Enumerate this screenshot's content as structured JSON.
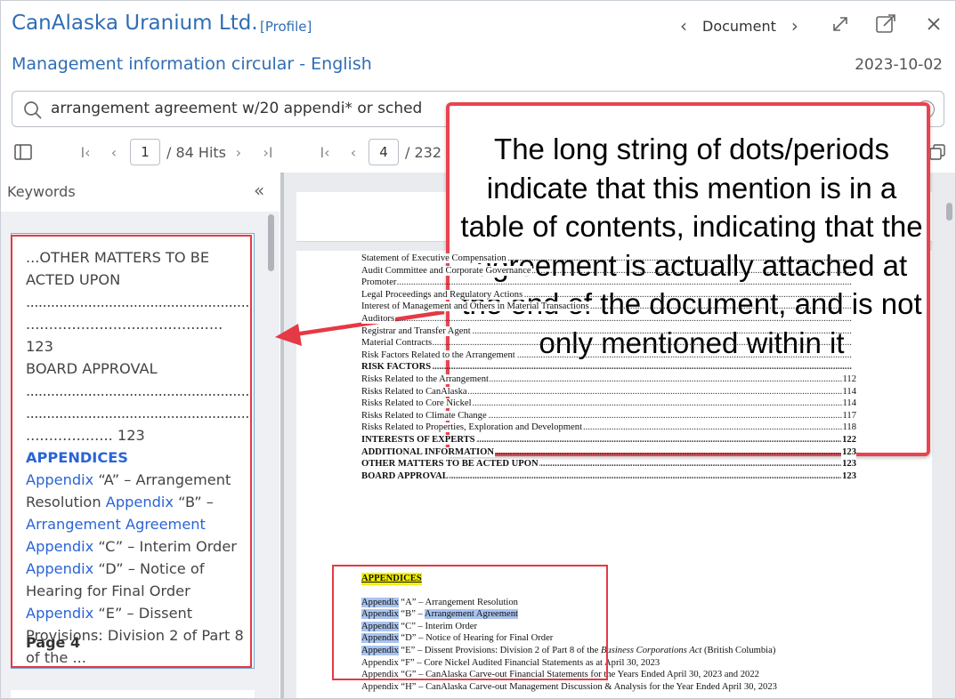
{
  "header": {
    "company": "CanAlaska Uranium Ltd.",
    "profile_link": "[Profile]",
    "doc_nav_label": "Document",
    "prev_icon": "chevron-left-icon",
    "next_icon": "chevron-right-icon",
    "expand_icon": "expand-icon",
    "open_external_icon": "open-external-icon",
    "close_icon": "close-icon",
    "subtitle": "Management information circular - English",
    "date": "2023-10-02"
  },
  "search": {
    "value": "arrangement agreement w/20 appendi* or sched"
  },
  "toolbar": {
    "hit_current": "1",
    "hit_total": "/ 84 Hits",
    "page_current": "4",
    "page_total": "/ 232"
  },
  "keywords_panel": {
    "label": "Keywords",
    "collapse_icon": "double-chevron-left-icon",
    "snippet": {
      "line1": "...OTHER MATTERS TO BE ACTED UPON",
      "dots1": "..............................................................",
      "dots2": "...........................................",
      "num1": "123",
      "line2": "BOARD APPROVAL",
      "dots3": "..............................................................",
      "dots4": "..............................................................",
      "dots5": "...................",
      "num2": "123",
      "kw_appendices": "APPENDICES",
      "kw_appendix": "Appendix",
      "a_text": "“A” – Arrangement Resolution",
      "b_text": "“B” –",
      "kw_arrangement_agreement": "Arrangement Agreement",
      "c_text": "“C” – Interim Order",
      "d_text": "“D” – Notice of Hearing for Final Order",
      "e_text": "“E” – Dissent Provisions: Division 2 of Part 8 of the ..."
    },
    "page_label": "Page 4"
  },
  "document": {
    "toc": [
      {
        "title": "Statement of Executive Compensation",
        "page": "",
        "bold": false
      },
      {
        "title": "Audit Committee and Corporate Governance",
        "page": "",
        "bold": false
      },
      {
        "title": "Promoter",
        "page": "",
        "bold": false
      },
      {
        "title": "Legal Proceedings and Regulatory Actions",
        "page": "",
        "bold": false
      },
      {
        "title": "Interest of Management and Others in Material Transactions",
        "page": "",
        "bold": false
      },
      {
        "title": "Auditors",
        "page": "",
        "bold": false
      },
      {
        "title": "Registrar and Transfer Agent",
        "page": "",
        "bold": false
      },
      {
        "title": "Material Contracts",
        "page": "",
        "bold": false
      },
      {
        "title": "Risk Factors Related to the Arrangement",
        "page": "",
        "bold": false
      },
      {
        "title": "RISK FACTORS",
        "page": "",
        "bold": true
      },
      {
        "title": "Risks Related to the Arrangement",
        "page": "112",
        "bold": false
      },
      {
        "title": "Risks Related to CanAlaska",
        "page": "114",
        "bold": false
      },
      {
        "title": "Risks Related to Core Nickel",
        "page": "114",
        "bold": false
      },
      {
        "title": "Risks Related to Climate Change",
        "page": "117",
        "bold": false
      },
      {
        "title": "Risks Related to Properties, Exploration and Development",
        "page": "118",
        "bold": false
      },
      {
        "title": "INTERESTS OF EXPERTS",
        "page": "122",
        "bold": true
      },
      {
        "title": "ADDITIONAL INFORMATION",
        "page": "123",
        "bold": true
      },
      {
        "title": "OTHER MATTERS TO BE ACTED UPON",
        "page": "123",
        "bold": true
      },
      {
        "title": "BOARD APPROVAL",
        "page": "123",
        "bold": true
      }
    ],
    "dot_leader": "................................................................................................................................................................................................................",
    "appendices_heading": "APPENDICES",
    "appendix_word": "Appendix",
    "arrangement_agreement": "Arrangement Agreement",
    "appx_a": " “A” – Arrangement Resolution",
    "appx_b": " “B” – ",
    "appx_c": " “C” – Interim Order",
    "appx_d": " “D” – Notice of Hearing for Final Order",
    "appx_e_pre": " “E” – Dissent Provisions: Division 2 of Part 8 of the ",
    "appx_e_italic": "Business Corporations Act",
    "appx_e_post": " (British Columbia)",
    "appx_f": "Appendix “F” – Core Nickel Audited Financial Statements as at April 30, 2023",
    "appx_g": "Appendix “G” – CanAlaska Carve-out Financial Statements for the Years Ended April 30, 2023 and 2022",
    "appx_h": "Appendix “H” – CanAlaska Carve-out Management Discussion & Analysis for the Year Ended April 30, 2023"
  },
  "callout": {
    "text": "The long string of dots/periods indicate that this mention is in a table of contents, indicating that the agreement is actually attached at the end of the document, and is not only mentioned within it"
  },
  "colors": {
    "brand_blue": "#2f6db5",
    "keyword_blue": "#2a64d6",
    "annotation_red": "#e53945",
    "highlight_yellow": "#f4f200",
    "highlight_blue": "#a9c3ee"
  }
}
